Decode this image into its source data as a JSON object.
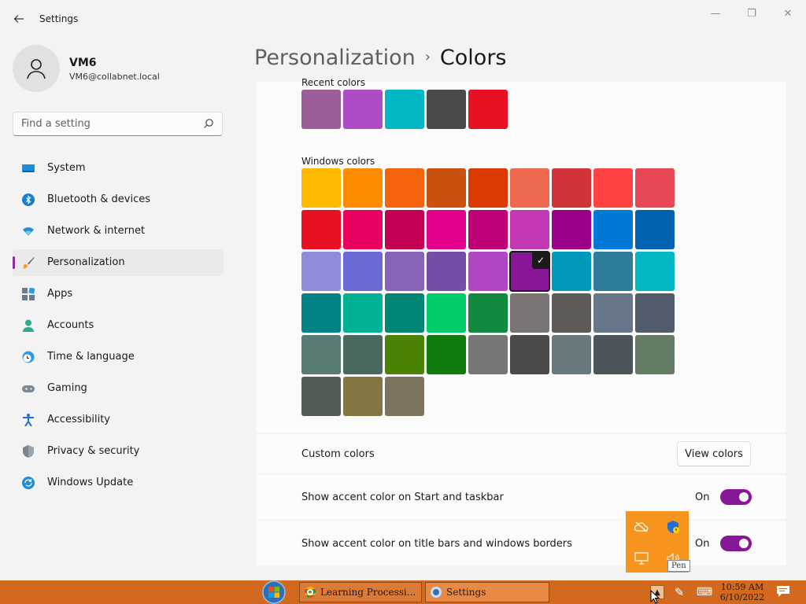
{
  "window": {
    "title": "Settings",
    "controls": {
      "minimize": "—",
      "maximize": "❐",
      "close": "✕"
    }
  },
  "user": {
    "name": "VM6",
    "email": "VM6@collabnet.local"
  },
  "search": {
    "placeholder": "Find a setting"
  },
  "nav": [
    {
      "label": "System",
      "icon": "system-icon"
    },
    {
      "label": "Bluetooth & devices",
      "icon": "bluetooth-icon"
    },
    {
      "label": "Network & internet",
      "icon": "wifi-icon"
    },
    {
      "label": "Personalization",
      "icon": "brush-icon",
      "active": true
    },
    {
      "label": "Apps",
      "icon": "apps-icon"
    },
    {
      "label": "Accounts",
      "icon": "person-icon"
    },
    {
      "label": "Time & language",
      "icon": "globe-clock-icon"
    },
    {
      "label": "Gaming",
      "icon": "gamepad-icon"
    },
    {
      "label": "Accessibility",
      "icon": "accessibility-icon"
    },
    {
      "label": "Privacy & security",
      "icon": "shield-icon"
    },
    {
      "label": "Windows Update",
      "icon": "update-icon"
    }
  ],
  "breadcrumb": {
    "parent": "Personalization",
    "separator": "›",
    "current": "Colors"
  },
  "recent_colors": {
    "label": "Recent colors",
    "colors": [
      "#9c5e9b",
      "#ad4cc4",
      "#00b7c3",
      "#4c4a48",
      "#e81123"
    ]
  },
  "windows_colors": {
    "label": "Windows colors",
    "selected_index": 23,
    "colors": [
      "#ffb900",
      "#ff8c00",
      "#f7630c",
      "#ca5010",
      "#da3b01",
      "#ef6950",
      "#d13438",
      "#ff4343",
      "#e74856",
      "#e81123",
      "#ea005e",
      "#c30052",
      "#e3008c",
      "#bf0077",
      "#c239b3",
      "#9a0089",
      "#0078d7",
      "#0063b1",
      "#8e8cd8",
      "#6b69d6",
      "#8764b8",
      "#744da9",
      "#b146c2",
      "#881798",
      "#0099bc",
      "#2d7d9a",
      "#00b7c3",
      "#038387",
      "#00b294",
      "#018574",
      "#00cc6a",
      "#10893e",
      "#7a7574",
      "#5d5a58",
      "#68768a",
      "#515c6b",
      "#567c73",
      "#486860",
      "#498205",
      "#107c10",
      "#767676",
      "#4c4a48",
      "#69797e",
      "#4a5459",
      "#647c64",
      "#525e54",
      "#847545",
      "#7e735f"
    ]
  },
  "custom_colors": {
    "label": "Custom colors",
    "button": "View colors"
  },
  "accent_start": {
    "label": "Show accent color on Start and taskbar",
    "state": "On"
  },
  "accent_titlebars": {
    "label": "Show accent color on title bars and windows borders",
    "state": "On"
  },
  "accent_color": "#881798",
  "tray_popup": {
    "tooltip": "Pen",
    "icons": [
      "cloud-offline-icon",
      "defender-warning-icon",
      "display-icon",
      "volume-icon"
    ]
  },
  "taskbar": {
    "buttons": [
      {
        "label": "Learning Processi...",
        "icon": "chrome-icon"
      },
      {
        "label": "Settings",
        "icon": "settings-app-icon"
      }
    ],
    "clock": {
      "time": "10:59 AM",
      "date": "6/10/2022"
    }
  }
}
